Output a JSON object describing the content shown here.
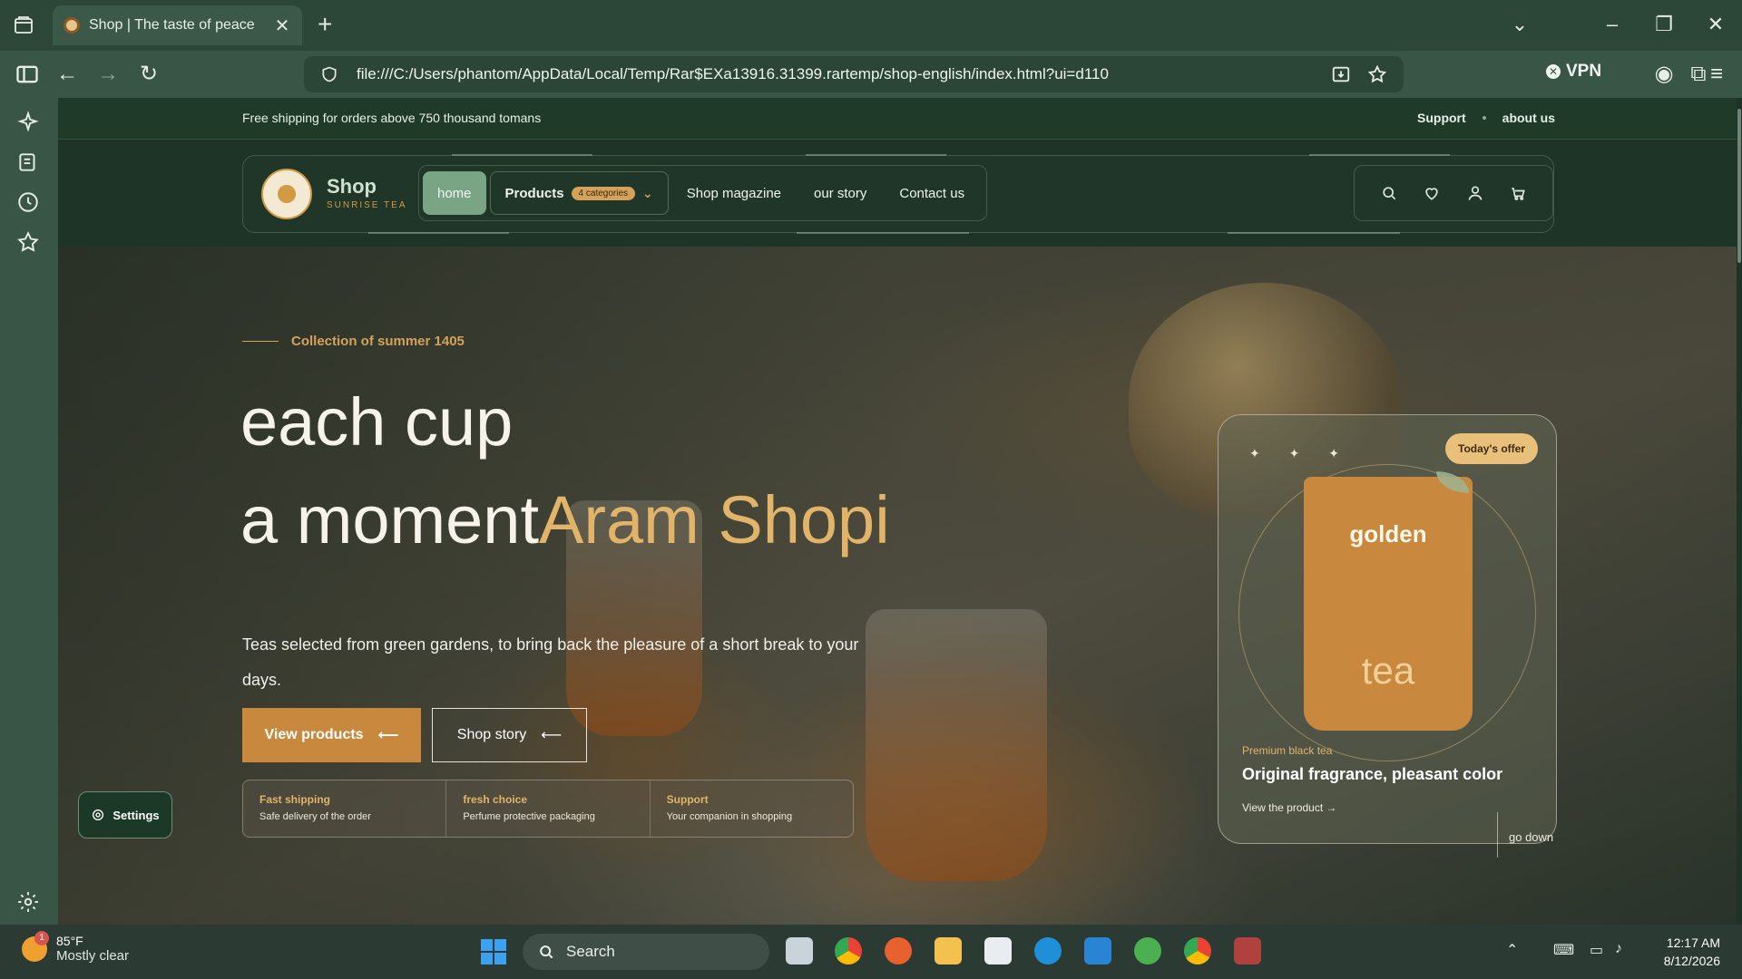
{
  "browser": {
    "tab_title": "Shop | The taste of peace",
    "tab_close": "✕",
    "new_tab": "+",
    "url": "file:///C:/Users/phantom/AppData/Local/Temp/Rar$EXa13916.31399.rartemp/shop-english/index.html?ui=d110",
    "vpn_label": "VPN"
  },
  "topbar": {
    "promo": "Free shipping for orders above 750 thousand tomans",
    "support": "Support",
    "about": "about us"
  },
  "header": {
    "brand_name": "Shop",
    "brand_sub": "SUNRISE TEA",
    "menu": {
      "home": "home",
      "products": "Products",
      "products_badge": "4 categories",
      "magazine": "Shop magazine",
      "story": "our story",
      "contact": "Contact us"
    }
  },
  "hero": {
    "kicker": "Collection of summer 1405",
    "headline_line1": "each cup",
    "headline_line2": "a moment",
    "headline_accent": "Aram Shopi",
    "lead": "Teas selected from green gardens, to bring back the pleasure of a short break to your days.",
    "primary_button": "View products",
    "secondary_button": "Shop story",
    "features": [
      {
        "title": "Fast shipping",
        "desc": "Safe delivery of the order"
      },
      {
        "title": "fresh choice",
        "desc": "Perfume protective packaging"
      },
      {
        "title": "Support",
        "desc": "Your companion in shopping"
      }
    ],
    "offer": {
      "badge": "Today's offer",
      "sparkles": "✦ ✦ ✦",
      "box_top": "golden",
      "box_bottom": "tea",
      "category": "Premium black tea",
      "title": "Original fragrance, pleasant color",
      "link": "View the product →"
    },
    "scroll_hint": "go down"
  },
  "settings_button": "Settings",
  "taskbar": {
    "temperature": "85°F",
    "condition": "Mostly clear",
    "weather_badge": "1",
    "search": "Search",
    "time": "12:17 AM",
    "date": "8/12/2026"
  },
  "colors": {
    "accent": "#c8893e",
    "accent_light": "#e1b46a",
    "brand_green": "#1f3a28",
    "active_menu": "#7aa585"
  }
}
